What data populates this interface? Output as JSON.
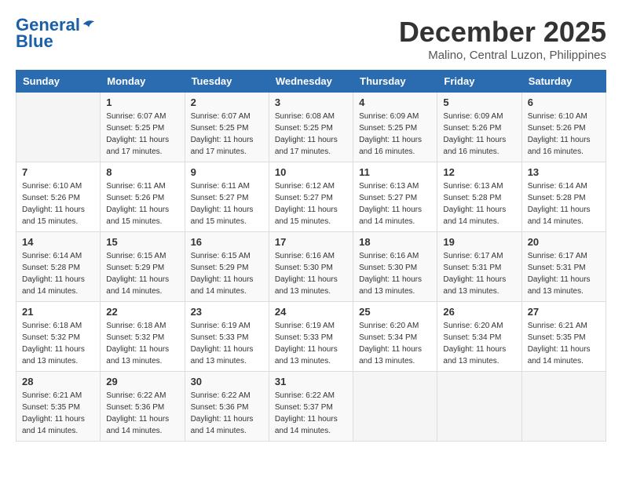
{
  "header": {
    "logo_line1": "General",
    "logo_line2": "Blue",
    "month_title": "December 2025",
    "location": "Malino, Central Luzon, Philippines"
  },
  "weekdays": [
    "Sunday",
    "Monday",
    "Tuesday",
    "Wednesday",
    "Thursday",
    "Friday",
    "Saturday"
  ],
  "weeks": [
    [
      {
        "day": "",
        "sunrise": "",
        "sunset": "",
        "daylight": ""
      },
      {
        "day": "1",
        "sunrise": "Sunrise: 6:07 AM",
        "sunset": "Sunset: 5:25 PM",
        "daylight": "Daylight: 11 hours and 17 minutes."
      },
      {
        "day": "2",
        "sunrise": "Sunrise: 6:07 AM",
        "sunset": "Sunset: 5:25 PM",
        "daylight": "Daylight: 11 hours and 17 minutes."
      },
      {
        "day": "3",
        "sunrise": "Sunrise: 6:08 AM",
        "sunset": "Sunset: 5:25 PM",
        "daylight": "Daylight: 11 hours and 17 minutes."
      },
      {
        "day": "4",
        "sunrise": "Sunrise: 6:09 AM",
        "sunset": "Sunset: 5:25 PM",
        "daylight": "Daylight: 11 hours and 16 minutes."
      },
      {
        "day": "5",
        "sunrise": "Sunrise: 6:09 AM",
        "sunset": "Sunset: 5:26 PM",
        "daylight": "Daylight: 11 hours and 16 minutes."
      },
      {
        "day": "6",
        "sunrise": "Sunrise: 6:10 AM",
        "sunset": "Sunset: 5:26 PM",
        "daylight": "Daylight: 11 hours and 16 minutes."
      }
    ],
    [
      {
        "day": "7",
        "sunrise": "Sunrise: 6:10 AM",
        "sunset": "Sunset: 5:26 PM",
        "daylight": "Daylight: 11 hours and 15 minutes."
      },
      {
        "day": "8",
        "sunrise": "Sunrise: 6:11 AM",
        "sunset": "Sunset: 5:26 PM",
        "daylight": "Daylight: 11 hours and 15 minutes."
      },
      {
        "day": "9",
        "sunrise": "Sunrise: 6:11 AM",
        "sunset": "Sunset: 5:27 PM",
        "daylight": "Daylight: 11 hours and 15 minutes."
      },
      {
        "day": "10",
        "sunrise": "Sunrise: 6:12 AM",
        "sunset": "Sunset: 5:27 PM",
        "daylight": "Daylight: 11 hours and 15 minutes."
      },
      {
        "day": "11",
        "sunrise": "Sunrise: 6:13 AM",
        "sunset": "Sunset: 5:27 PM",
        "daylight": "Daylight: 11 hours and 14 minutes."
      },
      {
        "day": "12",
        "sunrise": "Sunrise: 6:13 AM",
        "sunset": "Sunset: 5:28 PM",
        "daylight": "Daylight: 11 hours and 14 minutes."
      },
      {
        "day": "13",
        "sunrise": "Sunrise: 6:14 AM",
        "sunset": "Sunset: 5:28 PM",
        "daylight": "Daylight: 11 hours and 14 minutes."
      }
    ],
    [
      {
        "day": "14",
        "sunrise": "Sunrise: 6:14 AM",
        "sunset": "Sunset: 5:28 PM",
        "daylight": "Daylight: 11 hours and 14 minutes."
      },
      {
        "day": "15",
        "sunrise": "Sunrise: 6:15 AM",
        "sunset": "Sunset: 5:29 PM",
        "daylight": "Daylight: 11 hours and 14 minutes."
      },
      {
        "day": "16",
        "sunrise": "Sunrise: 6:15 AM",
        "sunset": "Sunset: 5:29 PM",
        "daylight": "Daylight: 11 hours and 14 minutes."
      },
      {
        "day": "17",
        "sunrise": "Sunrise: 6:16 AM",
        "sunset": "Sunset: 5:30 PM",
        "daylight": "Daylight: 11 hours and 13 minutes."
      },
      {
        "day": "18",
        "sunrise": "Sunrise: 6:16 AM",
        "sunset": "Sunset: 5:30 PM",
        "daylight": "Daylight: 11 hours and 13 minutes."
      },
      {
        "day": "19",
        "sunrise": "Sunrise: 6:17 AM",
        "sunset": "Sunset: 5:31 PM",
        "daylight": "Daylight: 11 hours and 13 minutes."
      },
      {
        "day": "20",
        "sunrise": "Sunrise: 6:17 AM",
        "sunset": "Sunset: 5:31 PM",
        "daylight": "Daylight: 11 hours and 13 minutes."
      }
    ],
    [
      {
        "day": "21",
        "sunrise": "Sunrise: 6:18 AM",
        "sunset": "Sunset: 5:32 PM",
        "daylight": "Daylight: 11 hours and 13 minutes."
      },
      {
        "day": "22",
        "sunrise": "Sunrise: 6:18 AM",
        "sunset": "Sunset: 5:32 PM",
        "daylight": "Daylight: 11 hours and 13 minutes."
      },
      {
        "day": "23",
        "sunrise": "Sunrise: 6:19 AM",
        "sunset": "Sunset: 5:33 PM",
        "daylight": "Daylight: 11 hours and 13 minutes."
      },
      {
        "day": "24",
        "sunrise": "Sunrise: 6:19 AM",
        "sunset": "Sunset: 5:33 PM",
        "daylight": "Daylight: 11 hours and 13 minutes."
      },
      {
        "day": "25",
        "sunrise": "Sunrise: 6:20 AM",
        "sunset": "Sunset: 5:34 PM",
        "daylight": "Daylight: 11 hours and 13 minutes."
      },
      {
        "day": "26",
        "sunrise": "Sunrise: 6:20 AM",
        "sunset": "Sunset: 5:34 PM",
        "daylight": "Daylight: 11 hours and 13 minutes."
      },
      {
        "day": "27",
        "sunrise": "Sunrise: 6:21 AM",
        "sunset": "Sunset: 5:35 PM",
        "daylight": "Daylight: 11 hours and 14 minutes."
      }
    ],
    [
      {
        "day": "28",
        "sunrise": "Sunrise: 6:21 AM",
        "sunset": "Sunset: 5:35 PM",
        "daylight": "Daylight: 11 hours and 14 minutes."
      },
      {
        "day": "29",
        "sunrise": "Sunrise: 6:22 AM",
        "sunset": "Sunset: 5:36 PM",
        "daylight": "Daylight: 11 hours and 14 minutes."
      },
      {
        "day": "30",
        "sunrise": "Sunrise: 6:22 AM",
        "sunset": "Sunset: 5:36 PM",
        "daylight": "Daylight: 11 hours and 14 minutes."
      },
      {
        "day": "31",
        "sunrise": "Sunrise: 6:22 AM",
        "sunset": "Sunset: 5:37 PM",
        "daylight": "Daylight: 11 hours and 14 minutes."
      },
      {
        "day": "",
        "sunrise": "",
        "sunset": "",
        "daylight": ""
      },
      {
        "day": "",
        "sunrise": "",
        "sunset": "",
        "daylight": ""
      },
      {
        "day": "",
        "sunrise": "",
        "sunset": "",
        "daylight": ""
      }
    ]
  ]
}
